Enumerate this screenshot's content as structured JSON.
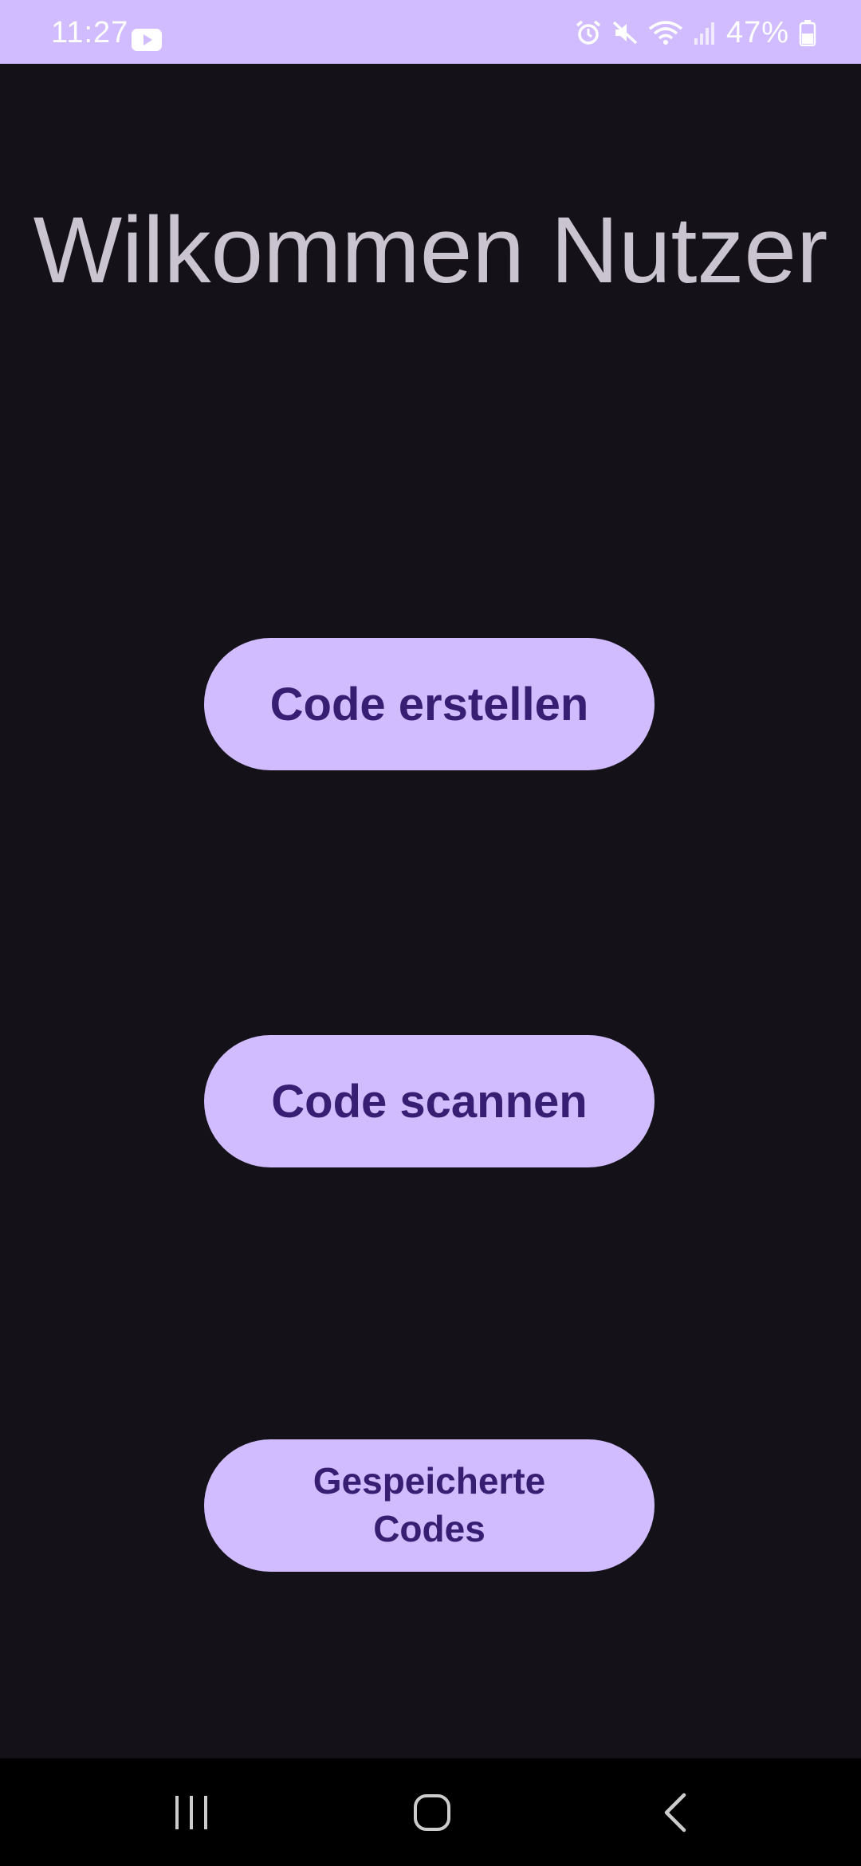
{
  "status_bar": {
    "time": "11:27",
    "battery_percent": "47%",
    "background": "#d0bcfe",
    "icons": [
      "youtube-icon",
      "alarm-icon",
      "mute-icon",
      "wifi-icon",
      "signal-icon",
      "battery-icon"
    ]
  },
  "main": {
    "title": "Wilkommen Nutzer",
    "buttons": {
      "create": "Code erstellen",
      "scan": "Code scannen",
      "saved_line1": "Gespeicherte",
      "saved_line2": "Codes"
    }
  },
  "nav_bar": {
    "icons": [
      "recent-apps-icon",
      "home-icon",
      "back-icon"
    ]
  },
  "colors": {
    "background": "#141218",
    "accent": "#d0bcfe",
    "on_accent": "#381e72",
    "title_text": "#cac4d0"
  }
}
